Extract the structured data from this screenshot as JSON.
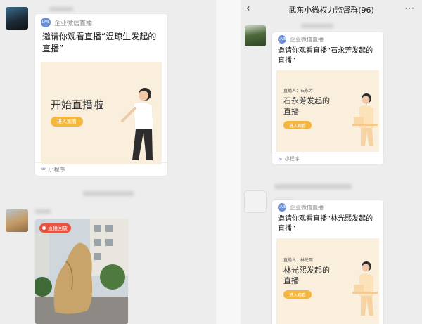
{
  "left": {
    "card1": {
      "source_label": "企业微信直播",
      "live_badge": "LIVE",
      "invite_text": "邀请你观看直播“温琼生发起的直播”",
      "cover_title": "开始直播啦",
      "enter_button": "进入观看",
      "footer": "小程序"
    },
    "replay_badge": "直播回放"
  },
  "right": {
    "header": {
      "back_icon": "‹",
      "title": "武东小微权力监督群(96)",
      "more_icon": "···"
    },
    "card1": {
      "source_label": "企业微信直播",
      "live_badge": "LIVE",
      "invite_text": "邀请你观看直播“石永芳发起的直播”",
      "streamer_label": "直播人：石永芳",
      "cover_title": "石永芳发起的直播",
      "enter_button": "进入观看",
      "footer": "小程序"
    },
    "card2": {
      "source_label": "企业微信直播",
      "live_badge": "LIVE",
      "invite_text": "邀请你观看直播“林光熙发起的直播”",
      "streamer_label": "直播人：林光熙",
      "cover_title": "林光熙发起的直播",
      "enter_button": "进入观看"
    }
  },
  "colors": {
    "chat_bg": "#ededed",
    "cover_bg": "#f9efdc",
    "accent_button": "#f4b63e",
    "live_badge": "#6b8fd6",
    "replay_badge": "#e8523f"
  }
}
